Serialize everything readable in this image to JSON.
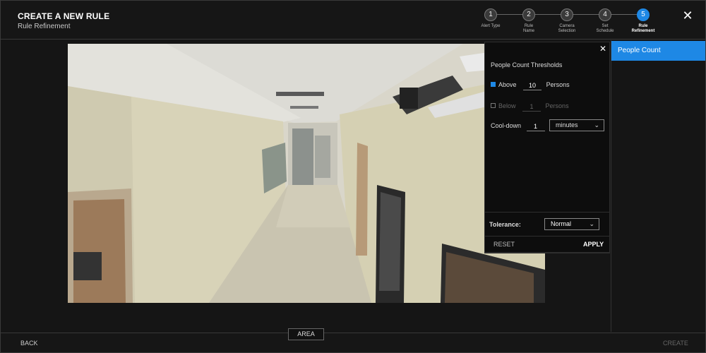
{
  "header": {
    "title": "CREATE A NEW RULE",
    "subtitle": "Rule Refinement",
    "close_icon": "close-icon",
    "steps": [
      {
        "number": "1",
        "label": "Alert Type"
      },
      {
        "number": "2",
        "label": "Rule Name"
      },
      {
        "number": "3",
        "label": "Camera Selection"
      },
      {
        "number": "4",
        "label": "Set Schedule"
      },
      {
        "number": "5",
        "label": "Rule Refinement"
      }
    ],
    "active_step": "5"
  },
  "sidebar": {
    "items": [
      {
        "label": "People Count"
      }
    ]
  },
  "panel": {
    "close_icon": "close-icon",
    "title": "People Count Thresholds",
    "above": {
      "label": "Above",
      "value": "10",
      "unit": "Persons",
      "checked": true
    },
    "below": {
      "label": "Below",
      "value": "1",
      "unit": "Persons",
      "checked": false
    },
    "cooldown": {
      "label": "Cool-down",
      "value": "1",
      "unit_selected": "minutes"
    },
    "tolerance": {
      "label": "Tolerance:",
      "selected": "Normal"
    },
    "reset_label": "RESET",
    "apply_label": "APPLY"
  },
  "bottom": {
    "back_label": "BACK",
    "area_label": "AREA",
    "create_label": "CREATE"
  },
  "colors": {
    "accent": "#1e88e5",
    "background": "#141414",
    "panel": "#0d0d0d"
  }
}
